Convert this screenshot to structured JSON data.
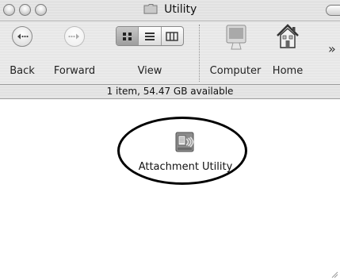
{
  "window": {
    "title": "Utility"
  },
  "toolbar": {
    "back_label": "Back",
    "forward_label": "Forward",
    "view_label": "View",
    "computer_label": "Computer",
    "home_label": "Home",
    "overflow_glyph": "»",
    "view_modes": [
      "icon-view",
      "list-view",
      "column-view"
    ],
    "view_selected": "icon-view"
  },
  "status": {
    "text": "1 item, 54.47 GB available"
  },
  "files": [
    {
      "name": "Attachment Utility",
      "icon": "application-icon"
    }
  ],
  "colors": {
    "highlight_ring": "#000000",
    "window_bg": "#ffffff"
  }
}
